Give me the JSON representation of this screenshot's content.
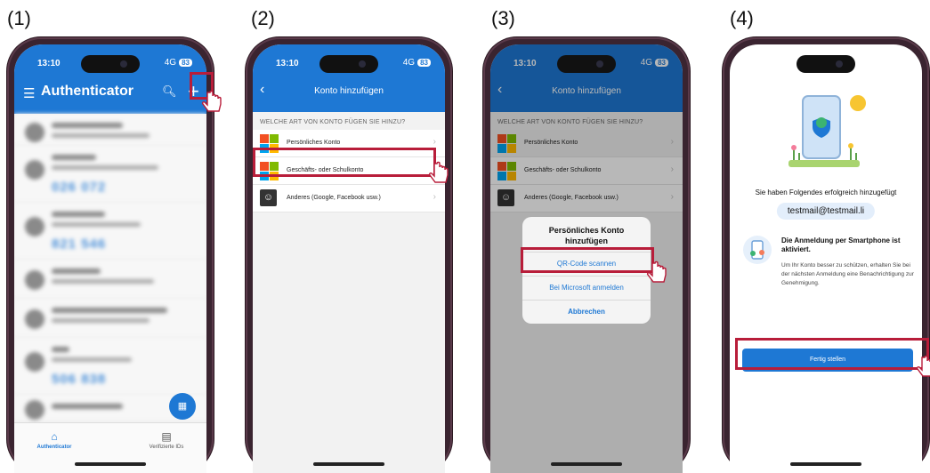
{
  "steps": [
    "(1)",
    "(2)",
    "(3)",
    "(4)"
  ],
  "status": {
    "time": "13:10",
    "network": "4G",
    "battery": "83"
  },
  "screen1": {
    "title": "Authenticator",
    "codes": [
      "026 072",
      "821 546",
      "506 838"
    ],
    "tabs": [
      "Authenticator",
      "Verifizierte IDs"
    ]
  },
  "screen2": {
    "nav_title": "Konto hinzufügen",
    "section": "WELCHE ART VON KONTO FÜGEN SIE HINZU?",
    "options": [
      "Persönliches Konto",
      "Geschäfts- oder Schulkonto",
      "Anderes (Google, Facebook usw.)"
    ]
  },
  "screen3": {
    "sheet_title": "Persönliches Konto hinzufügen",
    "sheet_options": [
      "QR-Code scannen",
      "Bei Microsoft anmelden",
      "Abbrechen"
    ]
  },
  "screen4": {
    "success": "Sie haben Folgendes erfolgreich hinzugefügt",
    "email": "testmail@testmail.li",
    "heading": "Die Anmeldung per Smartphone ist aktiviert.",
    "body": "Um Ihr Konto besser zu schützen, erhalten Sie bei der nächsten Anmel­dung eine Benachrichtigung zur Genehmigung.",
    "button": "Fertig stellen"
  },
  "colors": {
    "accent": "#1e78d4",
    "highlight": "#b81d3a",
    "frame": "#3a2430"
  },
  "icons": [
    "hamburger-menu-icon",
    "search-icon",
    "plus-icon",
    "qr-scan-icon",
    "home-icon",
    "id-card-icon",
    "back-chevron-icon",
    "chevron-right-icon",
    "microsoft-logo-icon",
    "person-icon",
    "tap-hand-icon"
  ]
}
